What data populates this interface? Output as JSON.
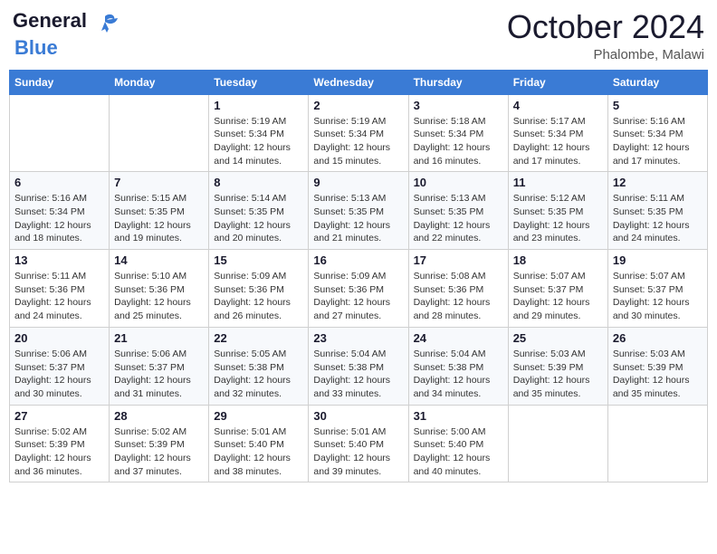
{
  "header": {
    "logo_line1": "General",
    "logo_line2": "Blue",
    "month": "October 2024",
    "location": "Phalombe, Malawi"
  },
  "days_of_week": [
    "Sunday",
    "Monday",
    "Tuesday",
    "Wednesday",
    "Thursday",
    "Friday",
    "Saturday"
  ],
  "weeks": [
    [
      {
        "day": "",
        "info": ""
      },
      {
        "day": "",
        "info": ""
      },
      {
        "day": "1",
        "info": "Sunrise: 5:19 AM\nSunset: 5:34 PM\nDaylight: 12 hours and 14 minutes."
      },
      {
        "day": "2",
        "info": "Sunrise: 5:19 AM\nSunset: 5:34 PM\nDaylight: 12 hours and 15 minutes."
      },
      {
        "day": "3",
        "info": "Sunrise: 5:18 AM\nSunset: 5:34 PM\nDaylight: 12 hours and 16 minutes."
      },
      {
        "day": "4",
        "info": "Sunrise: 5:17 AM\nSunset: 5:34 PM\nDaylight: 12 hours and 17 minutes."
      },
      {
        "day": "5",
        "info": "Sunrise: 5:16 AM\nSunset: 5:34 PM\nDaylight: 12 hours and 17 minutes."
      }
    ],
    [
      {
        "day": "6",
        "info": "Sunrise: 5:16 AM\nSunset: 5:34 PM\nDaylight: 12 hours and 18 minutes."
      },
      {
        "day": "7",
        "info": "Sunrise: 5:15 AM\nSunset: 5:35 PM\nDaylight: 12 hours and 19 minutes."
      },
      {
        "day": "8",
        "info": "Sunrise: 5:14 AM\nSunset: 5:35 PM\nDaylight: 12 hours and 20 minutes."
      },
      {
        "day": "9",
        "info": "Sunrise: 5:13 AM\nSunset: 5:35 PM\nDaylight: 12 hours and 21 minutes."
      },
      {
        "day": "10",
        "info": "Sunrise: 5:13 AM\nSunset: 5:35 PM\nDaylight: 12 hours and 22 minutes."
      },
      {
        "day": "11",
        "info": "Sunrise: 5:12 AM\nSunset: 5:35 PM\nDaylight: 12 hours and 23 minutes."
      },
      {
        "day": "12",
        "info": "Sunrise: 5:11 AM\nSunset: 5:35 PM\nDaylight: 12 hours and 24 minutes."
      }
    ],
    [
      {
        "day": "13",
        "info": "Sunrise: 5:11 AM\nSunset: 5:36 PM\nDaylight: 12 hours and 24 minutes."
      },
      {
        "day": "14",
        "info": "Sunrise: 5:10 AM\nSunset: 5:36 PM\nDaylight: 12 hours and 25 minutes."
      },
      {
        "day": "15",
        "info": "Sunrise: 5:09 AM\nSunset: 5:36 PM\nDaylight: 12 hours and 26 minutes."
      },
      {
        "day": "16",
        "info": "Sunrise: 5:09 AM\nSunset: 5:36 PM\nDaylight: 12 hours and 27 minutes."
      },
      {
        "day": "17",
        "info": "Sunrise: 5:08 AM\nSunset: 5:36 PM\nDaylight: 12 hours and 28 minutes."
      },
      {
        "day": "18",
        "info": "Sunrise: 5:07 AM\nSunset: 5:37 PM\nDaylight: 12 hours and 29 minutes."
      },
      {
        "day": "19",
        "info": "Sunrise: 5:07 AM\nSunset: 5:37 PM\nDaylight: 12 hours and 30 minutes."
      }
    ],
    [
      {
        "day": "20",
        "info": "Sunrise: 5:06 AM\nSunset: 5:37 PM\nDaylight: 12 hours and 30 minutes."
      },
      {
        "day": "21",
        "info": "Sunrise: 5:06 AM\nSunset: 5:37 PM\nDaylight: 12 hours and 31 minutes."
      },
      {
        "day": "22",
        "info": "Sunrise: 5:05 AM\nSunset: 5:38 PM\nDaylight: 12 hours and 32 minutes."
      },
      {
        "day": "23",
        "info": "Sunrise: 5:04 AM\nSunset: 5:38 PM\nDaylight: 12 hours and 33 minutes."
      },
      {
        "day": "24",
        "info": "Sunrise: 5:04 AM\nSunset: 5:38 PM\nDaylight: 12 hours and 34 minutes."
      },
      {
        "day": "25",
        "info": "Sunrise: 5:03 AM\nSunset: 5:39 PM\nDaylight: 12 hours and 35 minutes."
      },
      {
        "day": "26",
        "info": "Sunrise: 5:03 AM\nSunset: 5:39 PM\nDaylight: 12 hours and 35 minutes."
      }
    ],
    [
      {
        "day": "27",
        "info": "Sunrise: 5:02 AM\nSunset: 5:39 PM\nDaylight: 12 hours and 36 minutes."
      },
      {
        "day": "28",
        "info": "Sunrise: 5:02 AM\nSunset: 5:39 PM\nDaylight: 12 hours and 37 minutes."
      },
      {
        "day": "29",
        "info": "Sunrise: 5:01 AM\nSunset: 5:40 PM\nDaylight: 12 hours and 38 minutes."
      },
      {
        "day": "30",
        "info": "Sunrise: 5:01 AM\nSunset: 5:40 PM\nDaylight: 12 hours and 39 minutes."
      },
      {
        "day": "31",
        "info": "Sunrise: 5:00 AM\nSunset: 5:40 PM\nDaylight: 12 hours and 40 minutes."
      },
      {
        "day": "",
        "info": ""
      },
      {
        "day": "",
        "info": ""
      }
    ]
  ]
}
